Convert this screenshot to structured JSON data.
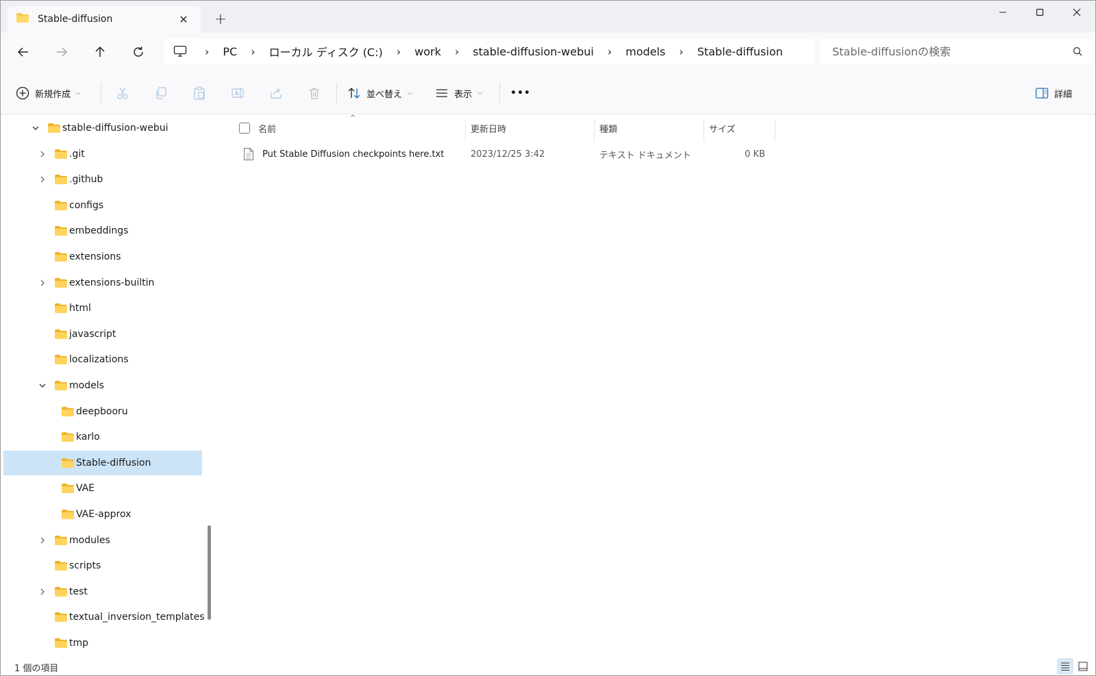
{
  "window": {
    "tab_title": "Stable-diffusion",
    "new_tab_label": "+",
    "close_tab_label": "✕"
  },
  "address": {
    "breadcrumbs": [
      "PC",
      "ローカル ディスク (C:)",
      "work",
      "stable-diffusion-webui",
      "models",
      "Stable-diffusion"
    ],
    "separator": "›"
  },
  "search": {
    "placeholder": "Stable-diffusionの検索"
  },
  "toolbar": {
    "new_label": "新規作成",
    "sort_label": "並べ替え",
    "view_label": "表示",
    "more_label": "•••",
    "details_label": "詳細"
  },
  "tree": {
    "items": [
      {
        "label": "stable-diffusion-webui",
        "expanded": true,
        "has_children": true
      },
      {
        "label": ".git",
        "expanded": false,
        "has_children": true
      },
      {
        "label": ".github",
        "expanded": false,
        "has_children": true
      },
      {
        "label": "configs",
        "has_children": false
      },
      {
        "label": "embeddings",
        "has_children": false
      },
      {
        "label": "extensions",
        "has_children": false
      },
      {
        "label": "extensions-builtin",
        "expanded": false,
        "has_children": true
      },
      {
        "label": "html",
        "has_children": false
      },
      {
        "label": "javascript",
        "has_children": false
      },
      {
        "label": "localizations",
        "has_children": false
      },
      {
        "label": "models",
        "expanded": true,
        "has_children": true
      },
      {
        "label": "deepbooru",
        "has_children": false
      },
      {
        "label": "karlo",
        "has_children": false
      },
      {
        "label": "Stable-diffusion",
        "has_children": false,
        "selected": true
      },
      {
        "label": "VAE",
        "has_children": false
      },
      {
        "label": "VAE-approx",
        "has_children": false
      },
      {
        "label": "modules",
        "expanded": false,
        "has_children": true
      },
      {
        "label": "scripts",
        "has_children": false
      },
      {
        "label": "test",
        "expanded": false,
        "has_children": true
      },
      {
        "label": "textual_inversion_templates",
        "has_children": false
      },
      {
        "label": "tmp",
        "has_children": false
      }
    ]
  },
  "columns": {
    "name": "名前",
    "modified": "更新日時",
    "type": "種類",
    "size": "サイズ",
    "sort_indicator": "^"
  },
  "files": [
    {
      "name": "Put Stable Diffusion checkpoints here.txt",
      "modified": "2023/12/25 3:42",
      "type": "テキスト ドキュメント",
      "size": "0 KB"
    }
  ],
  "status": {
    "item_count": "1 個の項目"
  },
  "colors": {
    "selected_bg": "#cce4f7",
    "folder_yellow": "#f8c94a",
    "chrome_bg": "#f9f9fb",
    "titlebar_bg": "#eef0f4"
  }
}
